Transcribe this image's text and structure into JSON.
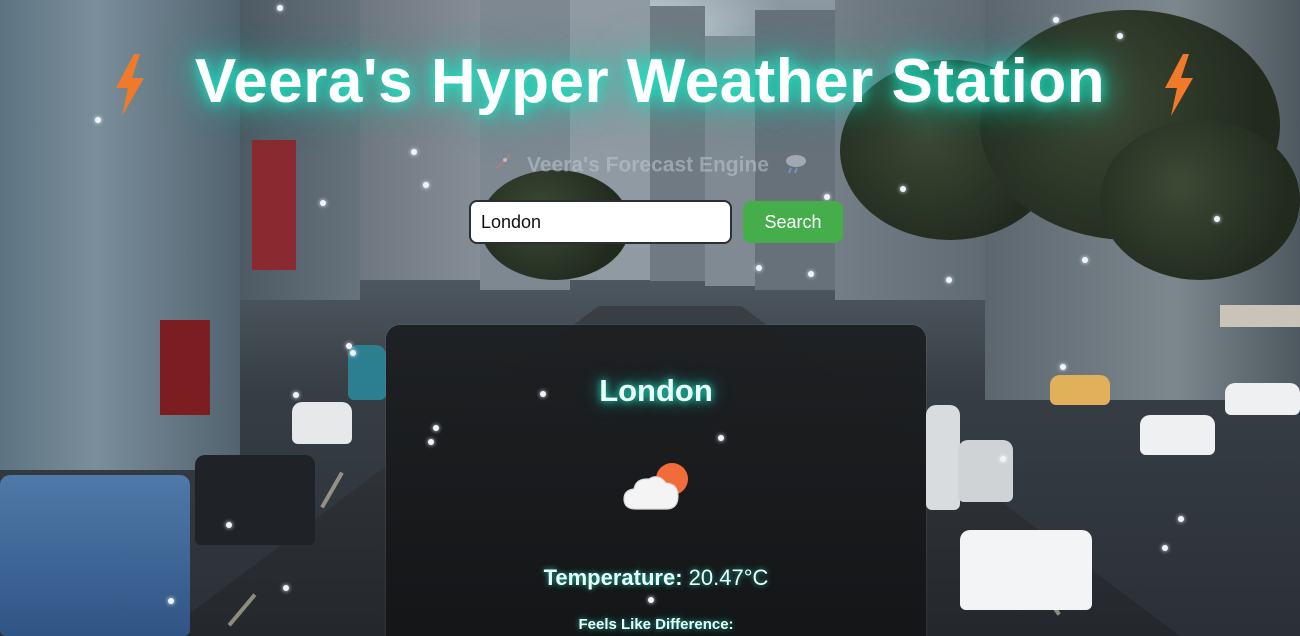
{
  "header": {
    "title": "Veera's Hyper Weather Station",
    "left_icon": "lightning-bolt-icon",
    "right_icon": "lightning-bolt-icon"
  },
  "subheader": {
    "text": "Veera's Forecast Engine",
    "left_icon": "rocket-icon",
    "right_icon": "cloud-rain-icon"
  },
  "search": {
    "value": "London",
    "button_label": "Search"
  },
  "weather_card": {
    "city": "London",
    "icon": "partly-cloudy-icon",
    "temperature_label": "Temperature:",
    "temperature_value": "20.47°C",
    "feels_like_label": "Feels Like Difference:"
  },
  "colors": {
    "accent_glow": "#1de9c6",
    "button": "#45ae4b",
    "bolt": "#f07a2a",
    "sun": "#f26b3a"
  }
}
